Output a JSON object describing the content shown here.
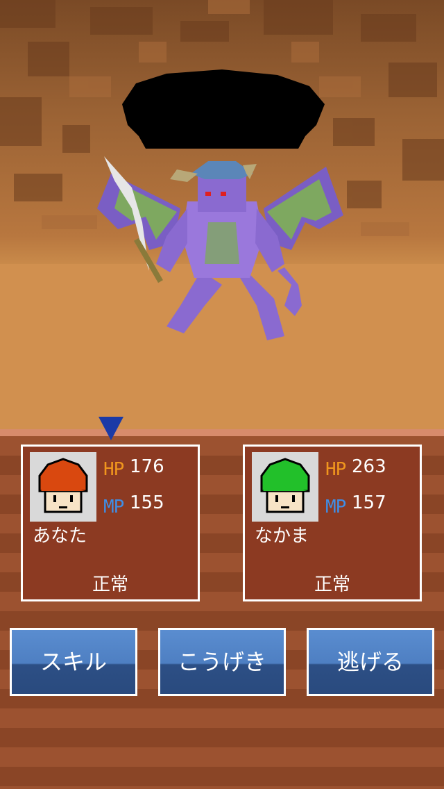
{
  "scene": {
    "enemy_name": ""
  },
  "party": [
    {
      "name": "あなた",
      "hp_label": "HP",
      "hp": "176",
      "mp_label": "MP",
      "mp": "155",
      "status": "正常",
      "hair_color": "#d9480f"
    },
    {
      "name": "なかま",
      "hp_label": "HP",
      "hp": "263",
      "mp_label": "MP",
      "mp": "157",
      "status": "正常",
      "hair_color": "#22c02a"
    }
  ],
  "commands": {
    "skill": "スキル",
    "attack": "こうげき",
    "flee": "逃げる"
  },
  "colors": {
    "hp_label": "#f0961e",
    "mp_label": "#3f8ee6",
    "cursor": "#1b3aa6",
    "button": "#4e7fc2"
  }
}
